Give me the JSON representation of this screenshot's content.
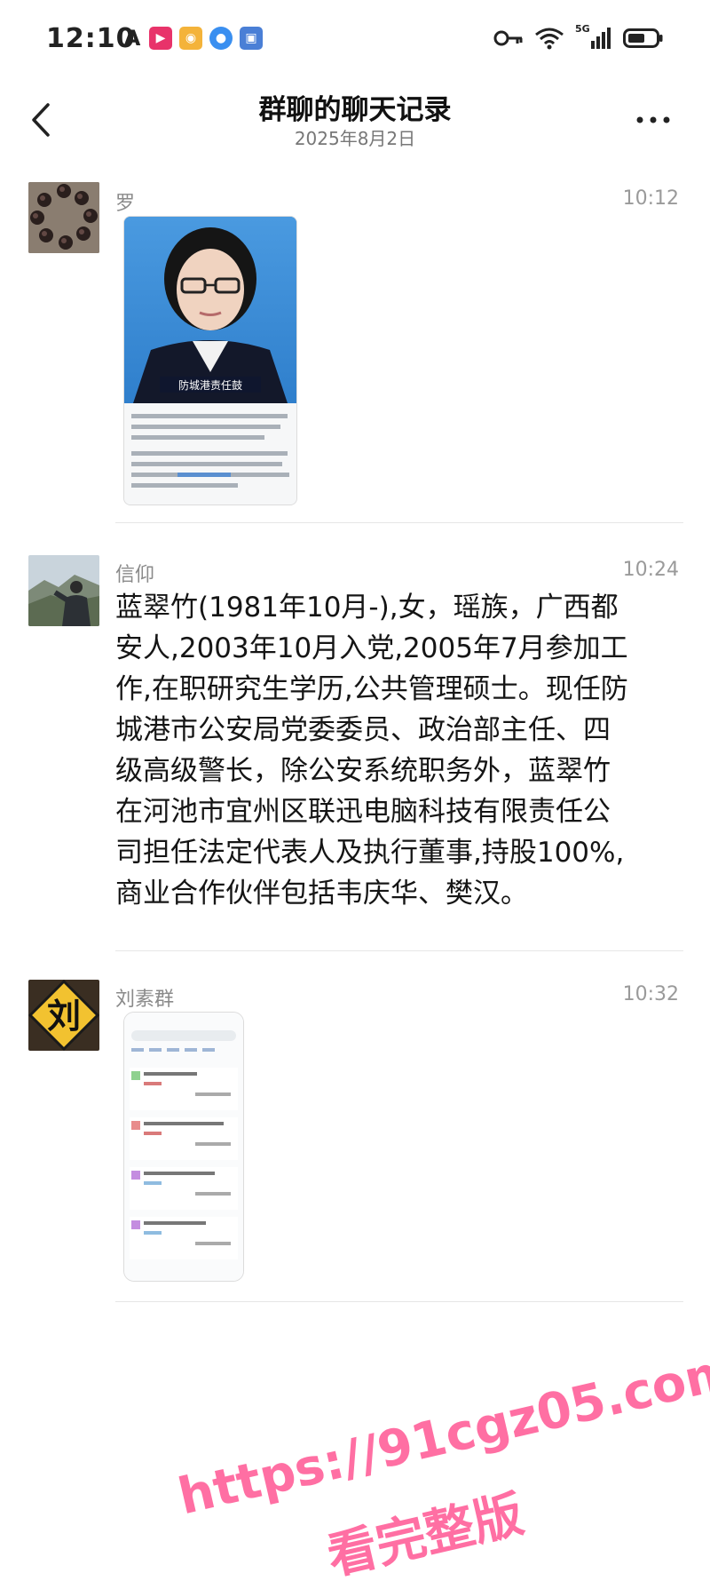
{
  "status_bar": {
    "time": "12:10",
    "app_icons": [
      "a-icon",
      "play-icon",
      "photo-icon",
      "browser-icon",
      "shield-icon"
    ],
    "network": "5G"
  },
  "header": {
    "title": "群聊的聊天记录",
    "date": "2025年8月2日"
  },
  "messages": [
    {
      "sender": "罗",
      "time": "10:12",
      "type": "image",
      "image": {
        "caption_banner": "防城港责任鼓"
      }
    },
    {
      "sender": "信仰",
      "time": "10:24",
      "type": "text",
      "text": "蓝翠竹(1981年10月-),女，瑶族，广西都\n安人,2003年10月入党,2005年7月参加工\n作,在职研究生学历,公共管理硕士。现任防\n城港市公安局党委委员、政治部主任、四\n级高级警长，除公安系统职务外，蓝翠竹\n在河池市宜州区联迅电脑科技有限责任公\n司担任法定代表人及执行董事,持股100%,\n商业合作伙伴包括韦庆华、樊汉。"
    },
    {
      "sender": "刘素群",
      "time": "10:32",
      "type": "image",
      "image": {
        "avatar_text": "刘"
      }
    }
  ],
  "watermark": {
    "line1": "https://91cgz05.com",
    "line2": "看完整版",
    "color": "#ff6fa3"
  }
}
